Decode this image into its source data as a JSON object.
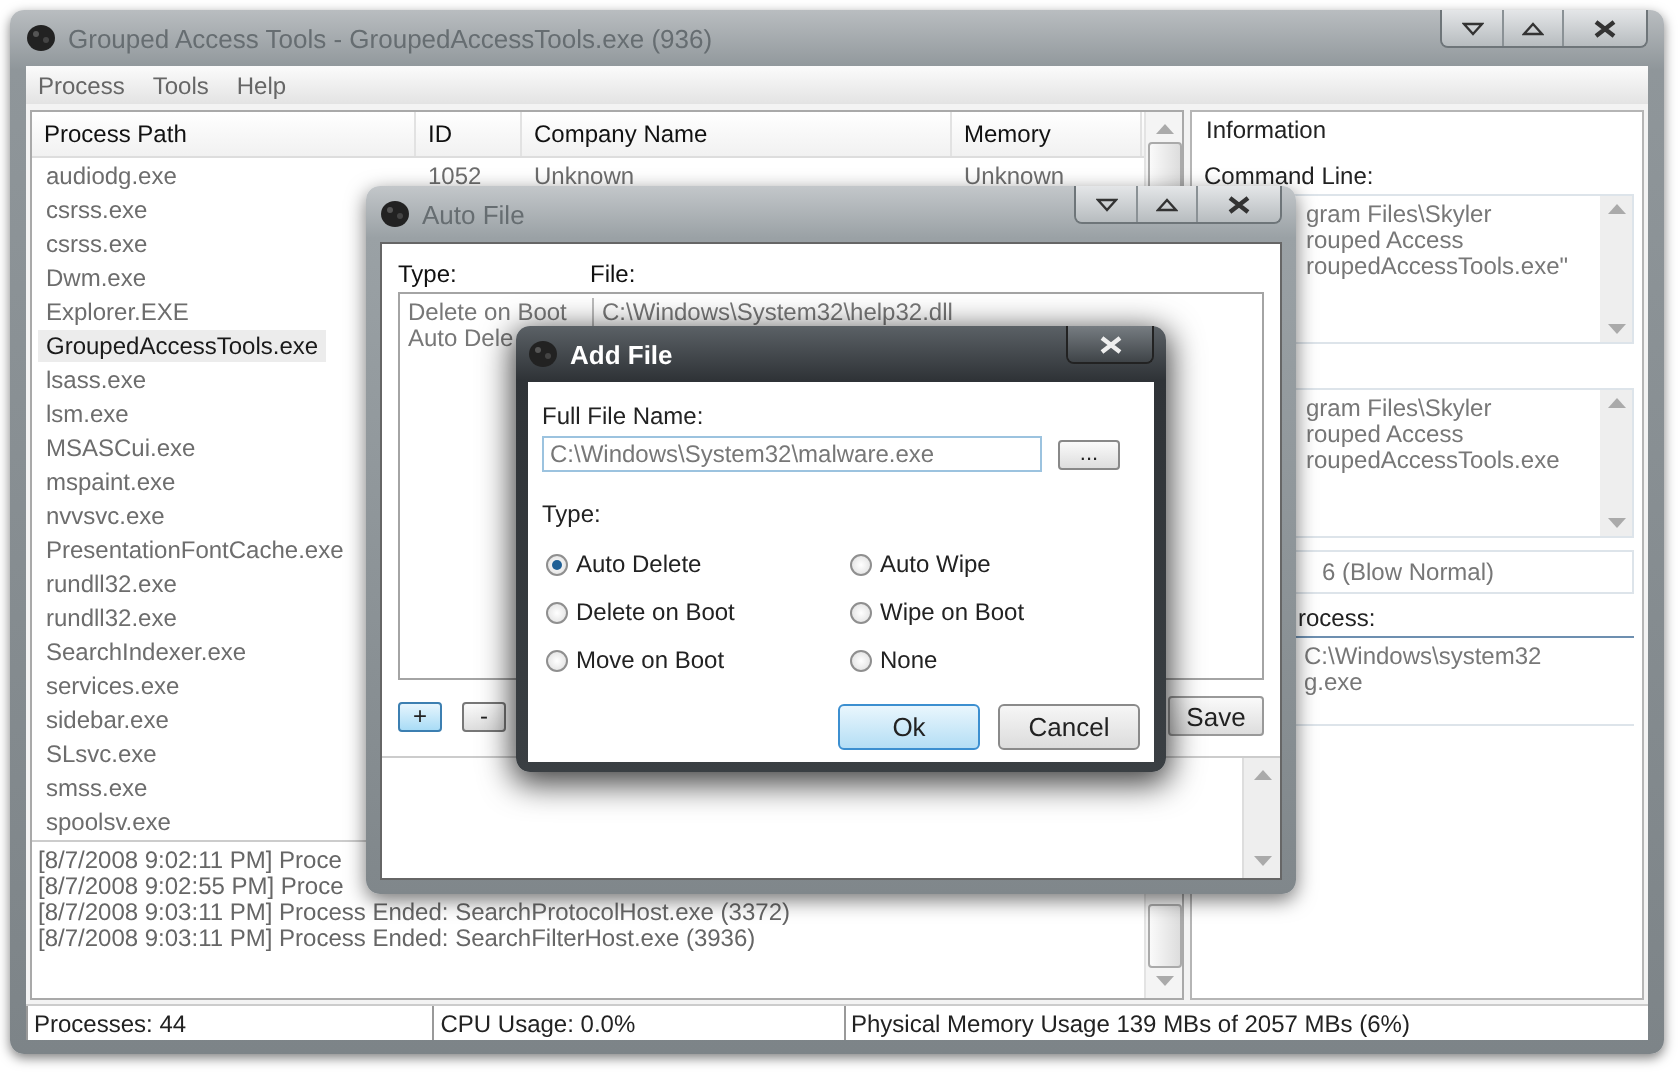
{
  "window": {
    "title": "Grouped Access Tools - GroupedAccessTools.exe (936)"
  },
  "menu": [
    "Process",
    "Tools",
    "Help"
  ],
  "process_table": {
    "columns": [
      "Process Path",
      "ID",
      "Company Name",
      "Memory"
    ],
    "rows": [
      {
        "path": "audiodg.exe",
        "id": "1052",
        "company": "Unknown",
        "memory": "Unknown",
        "selected": false
      },
      {
        "path": "csrss.exe",
        "selected": false
      },
      {
        "path": "csrss.exe",
        "selected": false
      },
      {
        "path": "Dwm.exe",
        "selected": false
      },
      {
        "path": "Explorer.EXE",
        "selected": false
      },
      {
        "path": "GroupedAccessTools.exe",
        "selected": true
      },
      {
        "path": "lsass.exe",
        "selected": false
      },
      {
        "path": "lsm.exe",
        "selected": false
      },
      {
        "path": "MSASCui.exe",
        "selected": false
      },
      {
        "path": "mspaint.exe",
        "selected": false
      },
      {
        "path": "nvvsvc.exe",
        "selected": false
      },
      {
        "path": "PresentationFontCache.exe",
        "selected": false
      },
      {
        "path": "rundll32.exe",
        "selected": false
      },
      {
        "path": "rundll32.exe",
        "selected": false
      },
      {
        "path": "SearchIndexer.exe",
        "selected": false
      },
      {
        "path": "services.exe",
        "selected": false
      },
      {
        "path": "sidebar.exe",
        "selected": false
      },
      {
        "path": "SLsvc.exe",
        "selected": false
      },
      {
        "path": "smss.exe",
        "selected": false
      },
      {
        "path": "spoolsv.exe",
        "selected": false
      }
    ]
  },
  "log": [
    "[8/7/2008 9:02:11 PM] Proce",
    "[8/7/2008 9:02:55 PM] Proce",
    "[8/7/2008 9:03:11 PM] Process Ended: SearchProtocolHost.exe (3372)",
    "[8/7/2008 9:03:11 PM] Process Ended: SearchFilterHost.exe (3936)"
  ],
  "information": {
    "title": "Information",
    "command_line_label": "Command Line:",
    "command_line": [
      "gram Files\\Skyler",
      "rouped Access",
      "roupedAccessTools.exe\""
    ],
    "path_box": [
      "gram Files\\Skyler",
      "rouped Access",
      "roupedAccessTools.exe"
    ],
    "priority": "6 (Blow Normal)",
    "parent_label": "rocess:",
    "parent_box": [
      "C:\\Windows\\system32",
      "g.exe"
    ]
  },
  "status_bar": [
    "Processes: 44",
    "CPU Usage: 0.0%",
    "Physical Memory Usage 139 MBs of 2057 MBs (6%)"
  ],
  "auto_file": {
    "title": "Auto File",
    "type_header": "Type:",
    "file_header": "File:",
    "entries": [
      {
        "type": "Delete on Boot",
        "file": "C:\\Windows\\System32\\help32.dll"
      },
      {
        "type": "Auto Dele"
      }
    ],
    "add_button": "+",
    "remove_button": "-",
    "save_button": "Save"
  },
  "add_file": {
    "title": "Add File",
    "full_name_label": "Full File Name:",
    "full_name": "C:\\Windows\\System32\\malware.exe",
    "browse_button": "...",
    "type_label": "Type:",
    "options": [
      {
        "label": "Auto Delete",
        "selected": true
      },
      {
        "label": "Delete on Boot",
        "selected": false
      },
      {
        "label": "Move on Boot",
        "selected": false
      },
      {
        "label": "Auto Wipe",
        "selected": false
      },
      {
        "label": "Wipe on Boot",
        "selected": false
      },
      {
        "label": "None",
        "selected": false
      }
    ],
    "ok_button": "Ok",
    "cancel_button": "Cancel"
  }
}
